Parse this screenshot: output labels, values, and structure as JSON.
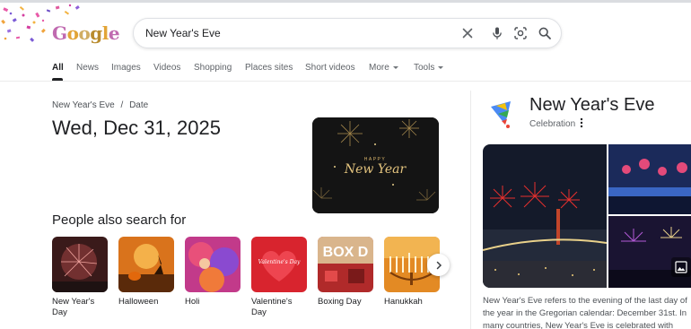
{
  "search": {
    "query": "New Year's Eve",
    "logo_text": "Google"
  },
  "tabs": [
    {
      "label": "All",
      "active": true
    },
    {
      "label": "News"
    },
    {
      "label": "Images"
    },
    {
      "label": "Videos"
    },
    {
      "label": "Shopping"
    },
    {
      "label": "Places sites"
    },
    {
      "label": "Short videos"
    },
    {
      "label": "More",
      "dropdown": true
    },
    {
      "label": "Tools",
      "dropdown": true
    }
  ],
  "answer": {
    "breadcrumb": {
      "topic": "New Year's Eve",
      "separator": "/",
      "attribute": "Date"
    },
    "date": "Wed, Dec 31, 2025",
    "image_text": {
      "line1": "HAPPY",
      "line2": "New Year"
    }
  },
  "people_also_search": {
    "title": "People also search for",
    "items": [
      {
        "label": "New Year's Day"
      },
      {
        "label": "Halloween"
      },
      {
        "label": "Holi"
      },
      {
        "label": "Valentine's Day",
        "thumb_text": "Valentine's Day"
      },
      {
        "label": "Boxing Day",
        "thumb_text": "BOX D"
      },
      {
        "label": "Hanukkah"
      }
    ]
  },
  "knowledge_panel": {
    "title": "New Year's Eve",
    "subtitle": "Celebration",
    "description": "New Year's Eve refers to the evening of the last day of the year in the Gregorian calendar: December 31st. In many countries, New Year's Eve is celebrated with dancing,"
  },
  "icons": {
    "clear": "close-icon",
    "mic": "microphone-icon",
    "lens": "lens-icon",
    "search": "search-icon",
    "next": "chevron-right-icon",
    "more": "more-vert-icon",
    "gallery": "image-gallery-icon"
  },
  "colors": {
    "text_primary": "#202124",
    "text_secondary": "#5f6368",
    "border": "#dfe1e5",
    "tab_active": "#202124"
  }
}
